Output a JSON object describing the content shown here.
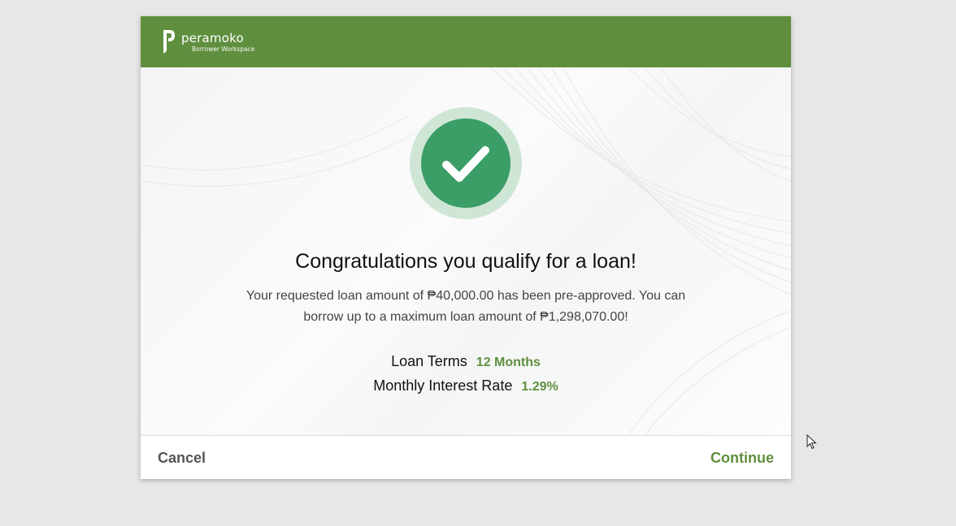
{
  "header": {
    "brand": "peramoko",
    "brand_sub": "Borrower Workspace"
  },
  "icons": {
    "logo": "peramoko-logo-icon",
    "check": "check-circle-icon",
    "cursor": "mouse-pointer-icon"
  },
  "colors": {
    "brand_green": "#5f8f3e",
    "check_green": "#3a9e66",
    "check_ring": "#cfe6d6"
  },
  "content": {
    "title": "Congratulations you qualify for a loan!",
    "desc_line1": "Your requested loan amount of ₱40,000.00 has been pre-approved. You can",
    "desc_line2": "borrow up to a maximum loan amount of ₱1,298,070.00!",
    "loan_terms_label": "Loan Terms",
    "loan_terms_value": "12 Months",
    "interest_label": "Monthly Interest Rate",
    "interest_value": "1.29%"
  },
  "footer": {
    "cancel_label": "Cancel",
    "continue_label": "Continue"
  }
}
